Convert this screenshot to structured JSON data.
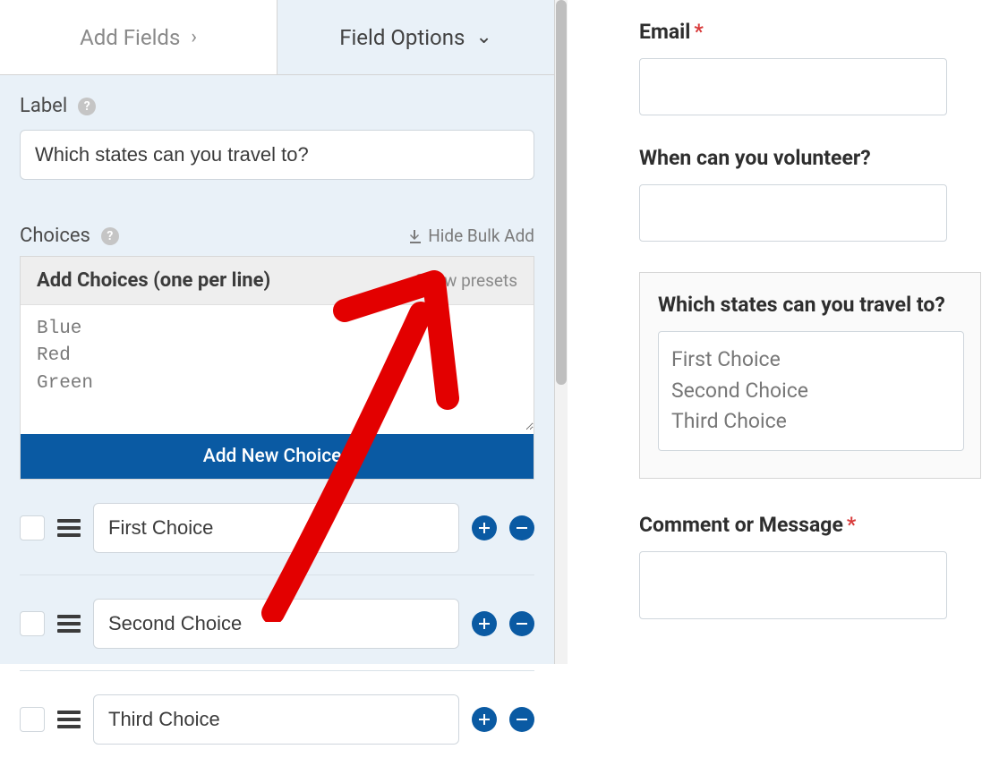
{
  "tabs": {
    "add_fields": "Add Fields",
    "field_options": "Field Options"
  },
  "label_section": {
    "title": "Label",
    "value": "Which states can you travel to?"
  },
  "choices_section": {
    "title": "Choices",
    "hide_bulk": "Hide Bulk Add",
    "bulk_title": "Add Choices (one per line)",
    "show_presets": "Show presets",
    "bulk_text": "Blue\nRed\nGreen",
    "add_button": "Add New Choices",
    "items": [
      {
        "value": "First Choice"
      },
      {
        "value": "Second Choice"
      },
      {
        "value": "Third Choice"
      }
    ]
  },
  "preview": {
    "email_label": "Email",
    "volunteer_label": "When can you volunteer?",
    "states_label": "Which states can you travel to?",
    "states_options": [
      "First Choice",
      "Second Choice",
      "Third Choice"
    ],
    "comment_label": "Comment or Message"
  }
}
